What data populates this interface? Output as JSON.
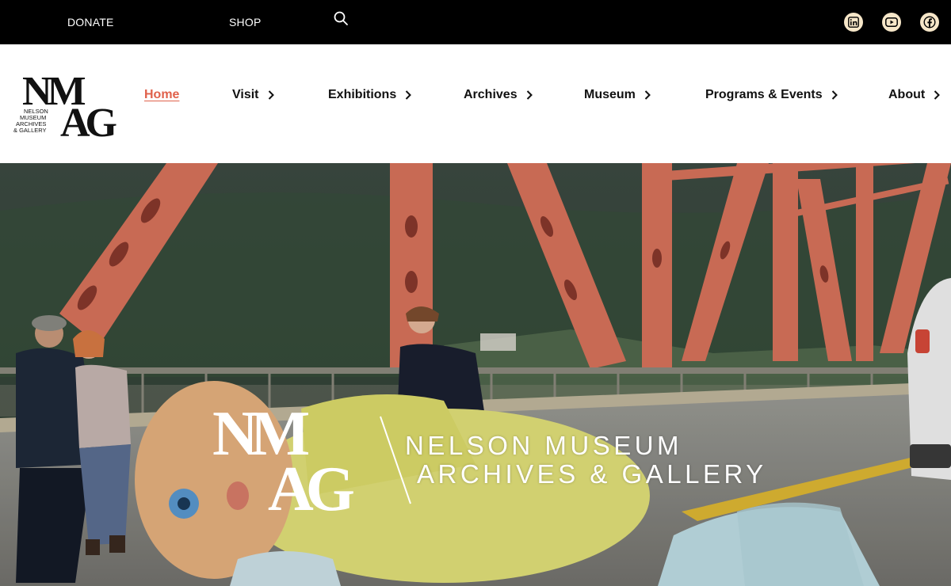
{
  "topbar": {
    "donate_label": "DONATE",
    "shop_label": "SHOP",
    "search_icon": "search-icon",
    "social": [
      {
        "name": "linkedin-icon",
        "glyph": "in"
      },
      {
        "name": "youtube-icon",
        "glyph": "▶"
      },
      {
        "name": "facebook-icon",
        "glyph": "f"
      }
    ]
  },
  "logo": {
    "letters_top": "NM",
    "letters_bottom": "AG",
    "line1": "NELSON",
    "line2": "MUSEUM",
    "line3": "ARCHIVES",
    "line4": "& GALLERY"
  },
  "nav": {
    "items": [
      {
        "label": "Home",
        "active": true
      },
      {
        "label": "Visit"
      },
      {
        "label": "Exhibitions"
      },
      {
        "label": "Archives"
      },
      {
        "label": "Museum"
      },
      {
        "label": "Programs & Events"
      },
      {
        "label": "About"
      }
    ],
    "active_color": "#e0614b"
  },
  "hero": {
    "brand_line1": "NELSON MUSEUM",
    "brand_line2": "ARCHIVES & GALLERY",
    "monogram_top": "NM",
    "monogram_bottom": "AG"
  },
  "colors": {
    "topbar_bg": "#000000",
    "social_bg": "#f6e6c8",
    "bridge": "#d9735c"
  }
}
